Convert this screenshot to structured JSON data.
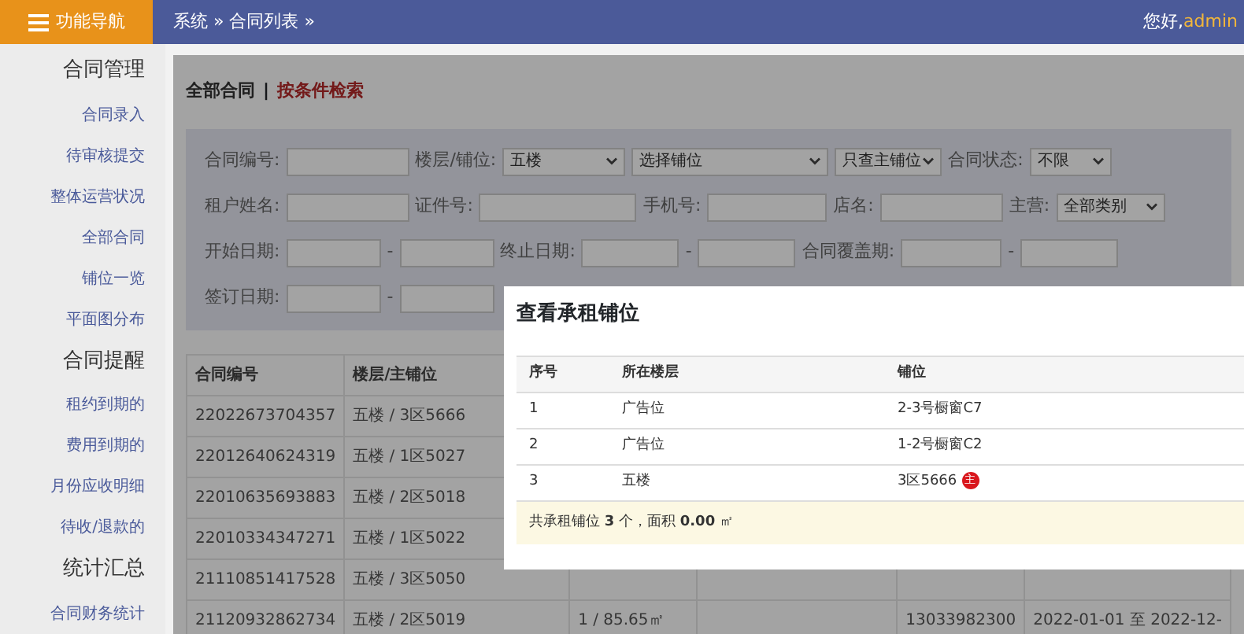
{
  "nav_button": {
    "label": "功能导航"
  },
  "breadcrumb": "系统 » 合同列表 »",
  "greeting": {
    "text": "您好,",
    "user": "admin"
  },
  "sidebar": {
    "sections": [
      {
        "title": "合同管理",
        "items": [
          "合同录入",
          "待审核提交",
          "整体运营状况",
          "全部合同",
          "铺位一览",
          "平面图分布"
        ]
      },
      {
        "title": "合同提醒",
        "items": [
          "租约到期的",
          "费用到期的",
          "月份应收明细",
          "待收/退款的"
        ]
      },
      {
        "title": "统计汇总",
        "items": [
          "合同财务统计"
        ]
      }
    ]
  },
  "tabs": [
    {
      "label": "全部合同",
      "selected": true
    },
    {
      "label": "按条件检索",
      "selected": false
    }
  ],
  "tab_separator": "|",
  "filters": [
    [
      {
        "kind": "label",
        "text": "合同编号:"
      },
      {
        "kind": "input"
      },
      {
        "kind": "label",
        "text": "楼层/铺位:"
      },
      {
        "kind": "select",
        "text": "五楼"
      },
      {
        "kind": "select",
        "text": "选择铺位"
      },
      {
        "kind": "select",
        "text": "只查主铺位"
      },
      {
        "kind": "label",
        "text": "合同状态:"
      },
      {
        "kind": "select",
        "text": "不限"
      }
    ],
    [
      {
        "kind": "label",
        "text": "租户姓名:"
      },
      {
        "kind": "input"
      },
      {
        "kind": "label",
        "text": "证件号:"
      },
      {
        "kind": "input"
      },
      {
        "kind": "label",
        "text": "手机号:"
      },
      {
        "kind": "input"
      },
      {
        "kind": "label",
        "text": "店名:"
      },
      {
        "kind": "input"
      },
      {
        "kind": "label",
        "text": "主营:"
      },
      {
        "kind": "select",
        "text": "全部类别"
      }
    ],
    [
      {
        "kind": "label",
        "text": "开始日期:"
      },
      {
        "kind": "input"
      },
      {
        "kind": "label",
        "text": "-"
      },
      {
        "kind": "input"
      },
      {
        "kind": "label",
        "text": "终止日期:"
      },
      {
        "kind": "input"
      },
      {
        "kind": "label",
        "text": "-"
      },
      {
        "kind": "input"
      },
      {
        "kind": "label",
        "text": "合同覆盖期:"
      },
      {
        "kind": "input"
      },
      {
        "kind": "label",
        "text": "-"
      },
      {
        "kind": "input"
      }
    ],
    [
      {
        "kind": "label",
        "text": "签订日期:"
      },
      {
        "kind": "input"
      },
      {
        "kind": "label",
        "text": "-"
      },
      {
        "kind": "input"
      }
    ]
  ],
  "table": {
    "columns": [
      "合同编号",
      "楼层/主铺位"
    ],
    "rows": [
      {
        "cells": [
          "22022673704357",
          "五楼 / 3区5666"
        ]
      },
      {
        "cells": [
          "22012640624319",
          "五楼 / 1区5027"
        ]
      },
      {
        "cells": [
          "22010635693883",
          "五楼 / 2区5018"
        ]
      },
      {
        "cells": [
          "22010334347271",
          "五楼 / 1区5022"
        ]
      },
      {
        "cells": [
          "21110851417528",
          "五楼 / 3区5050"
        ]
      },
      {
        "cells": [
          "21120932862734",
          "五楼 / 2区5019",
          "1 / 85.65㎡",
          null,
          "13033982300",
          "2022-01-01 至 2022-12-"
        ]
      }
    ]
  },
  "modal": {
    "title": "查看承租铺位",
    "columns": [
      "序号",
      "所在楼层",
      "铺位"
    ],
    "rows": [
      {
        "cells": [
          "1",
          "广告位",
          "2-3号橱窗C7"
        ]
      },
      {
        "cells": [
          "2",
          "广告位",
          "1-2号橱窗C2"
        ]
      },
      {
        "cells": [
          "3",
          "五楼",
          "3区5666"
        ],
        "badge": "主"
      }
    ],
    "summary": "共承租铺位 **3** 个，面积 **0.00** ㎡"
  }
}
